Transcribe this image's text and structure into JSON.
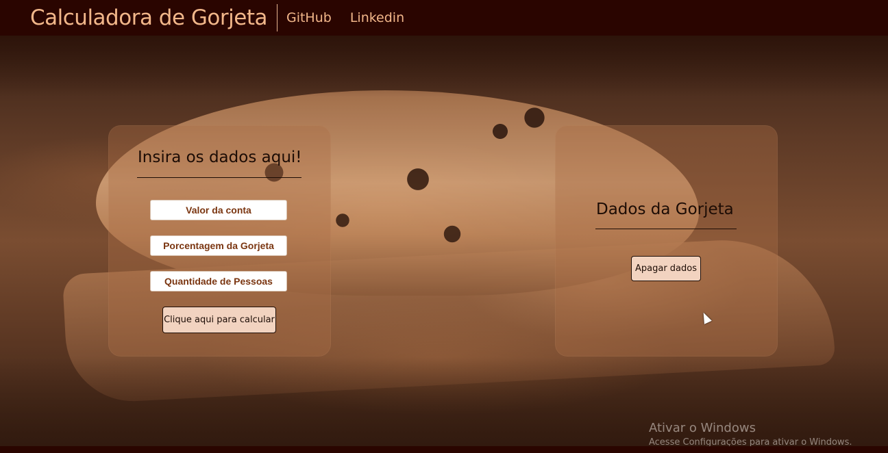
{
  "navbar": {
    "brand": "Calculadora de Gorjeta",
    "links": [
      {
        "label": "GitHub"
      },
      {
        "label": "Linkedin"
      }
    ]
  },
  "input_panel": {
    "title": "Insira os dados aqui!",
    "fields": [
      {
        "placeholder": "Valor da conta",
        "value": ""
      },
      {
        "placeholder": "Porcentagem da Gorjeta",
        "value": ""
      },
      {
        "placeholder": "Quantidade de Pessoas",
        "value": ""
      }
    ],
    "calculate_label": "Clique aqui para calcular"
  },
  "result_panel": {
    "title": "Dados da Gorjeta",
    "clear_label": "Apagar dados"
  },
  "watermark": {
    "line1": "Ativar o Windows",
    "line2": "Acesse Configurações para ativar o Windows."
  },
  "colors": {
    "navbar_bg": "#2a0500",
    "brand_text": "#f2b78a",
    "field_text": "#7a3510",
    "button_bg": "#f2d3c0"
  },
  "icons": {
    "cursor": "mouse-pointer-icon"
  }
}
